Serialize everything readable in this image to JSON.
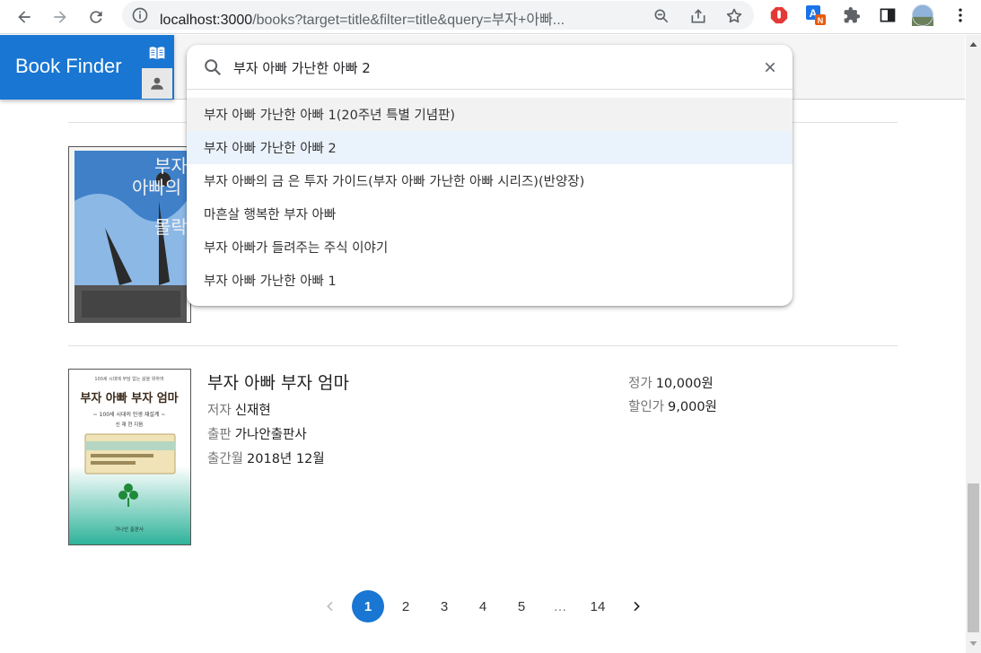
{
  "browser": {
    "url_host": "localhost:3000",
    "url_path": "/books?target=title&filter=title&query=부자+아빠...",
    "colors": {
      "toolbar": "#ffffff",
      "omnibox": "#f1f3f4"
    }
  },
  "app": {
    "title": "Book Finder",
    "tabs": [
      {
        "icon": "book-icon"
      },
      {
        "icon": "person-icon"
      }
    ],
    "colors": {
      "primary": "#1976d2"
    }
  },
  "search": {
    "value": "부자 아빠 가난한 아빠 2",
    "suggestions": [
      "부자 아빠 가난한 아빠 1(20주년 특별 기념판)",
      "부자 아빠 가난한 아빠 2",
      "부자 아빠의 금 은 투자 가이드(부자 아빠 가난한 아빠 시리즈)(반양장)",
      "마흔살 행복한 부자 아빠",
      "부자 아빠가 들려주는 주식 이야기",
      "부자 아빠 가난한 아빠 1"
    ]
  },
  "books": [
    {
      "cover_text": "부자 아빠의 몰락"
    },
    {
      "title": "부자 아빠 부자 엄마",
      "author_label": "저자",
      "author": "신재현",
      "publisher_label": "출판",
      "publisher": "가나안출판사",
      "date_label": "출간월",
      "date": "2018년 12월",
      "price_label": "정가",
      "price": "10,000원",
      "sale_label": "할인가",
      "sale": "9,000원",
      "cover_text": "부자 아빠 부자 엄마",
      "cover_sub": "~ 100세 시대의 인생 재설계 ~",
      "cover_author": "신 재 현 지음",
      "cover_publisher": "가나안 출판사",
      "cover_top": "100세 시대에 부담 없는 삶을 위하여"
    }
  ],
  "pagination": {
    "pages": [
      "1",
      "2",
      "3",
      "4",
      "5",
      "…",
      "14"
    ],
    "current": "1"
  }
}
